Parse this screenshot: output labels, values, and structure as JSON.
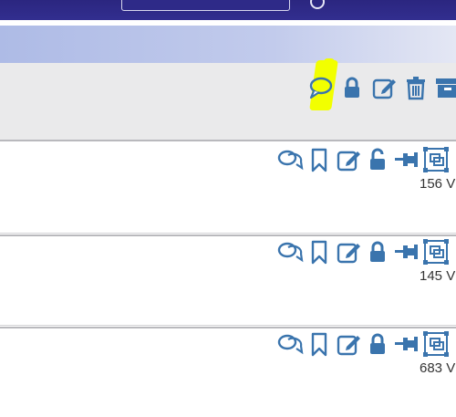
{
  "header": {
    "icons": [
      "search-field",
      "user-icon"
    ]
  },
  "thread_toolbar": {
    "icons": [
      "reply-icon",
      "lock-icon",
      "edit-icon",
      "delete-icon",
      "archive-icon"
    ]
  },
  "posts": [
    {
      "views_label": "156 V",
      "lock_state": "unlocked"
    },
    {
      "views_label": "145 V",
      "lock_state": "locked"
    },
    {
      "views_label": "683 V",
      "lock_state": "locked"
    }
  ],
  "colors": {
    "icon_blue": "#3a74ad",
    "header": "#2b2680",
    "highlight": "#f2ff00"
  }
}
